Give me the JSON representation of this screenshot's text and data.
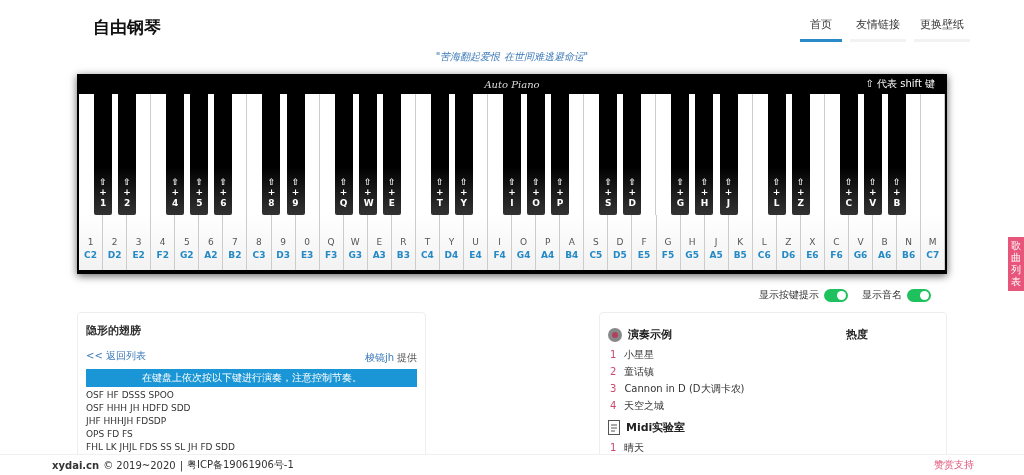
{
  "header": {
    "title": "自由钢琴",
    "nav": [
      {
        "label": "首页",
        "selected": true
      },
      {
        "label": "友情链接",
        "selected": false
      },
      {
        "label": "更换壁纸",
        "selected": false
      }
    ]
  },
  "motto": "\"苦海翻起爱恨 在世间难逃避命运\"",
  "piano": {
    "brand": "Auto Piano",
    "shift_note": "⇧ 代表 shift 键",
    "keys": [
      {
        "key": "1",
        "note": "C2",
        "black": "⇧ + 1"
      },
      {
        "key": "2",
        "note": "D2",
        "black": "⇧ + 2"
      },
      {
        "key": "3",
        "note": "E2"
      },
      {
        "key": "4",
        "note": "F2",
        "black": "⇧ + 4"
      },
      {
        "key": "5",
        "note": "G2",
        "black": "⇧ + 5"
      },
      {
        "key": "6",
        "note": "A2",
        "black": "⇧ + 6"
      },
      {
        "key": "7",
        "note": "B2"
      },
      {
        "key": "8",
        "note": "C3",
        "black": "⇧ + 8"
      },
      {
        "key": "9",
        "note": "D3",
        "black": "⇧ + 9"
      },
      {
        "key": "0",
        "note": "E3"
      },
      {
        "key": "Q",
        "note": "F3",
        "black": "⇧ + Q"
      },
      {
        "key": "W",
        "note": "G3",
        "black": "⇧ + W"
      },
      {
        "key": "E",
        "note": "A3",
        "black": "⇧ + E"
      },
      {
        "key": "R",
        "note": "B3"
      },
      {
        "key": "T",
        "note": "C4",
        "black": "⇧ + T"
      },
      {
        "key": "Y",
        "note": "D4",
        "black": "⇧ + Y"
      },
      {
        "key": "U",
        "note": "E4"
      },
      {
        "key": "I",
        "note": "F4",
        "black": "⇧ + I"
      },
      {
        "key": "O",
        "note": "G4",
        "black": "⇧ + O"
      },
      {
        "key": "P",
        "note": "A4",
        "black": "⇧ + P"
      },
      {
        "key": "A",
        "note": "B4"
      },
      {
        "key": "S",
        "note": "C5",
        "black": "⇧ + S"
      },
      {
        "key": "D",
        "note": "D5",
        "black": "⇧ + D"
      },
      {
        "key": "F",
        "note": "E5"
      },
      {
        "key": "G",
        "note": "F5",
        "black": "⇧ + G"
      },
      {
        "key": "H",
        "note": "G5",
        "black": "⇧ + H"
      },
      {
        "key": "J",
        "note": "A5",
        "black": "⇧ + J"
      },
      {
        "key": "K",
        "note": "B5"
      },
      {
        "key": "L",
        "note": "C6",
        "black": "⇧ + L"
      },
      {
        "key": "Z",
        "note": "D6",
        "black": "⇧ + Z"
      },
      {
        "key": "X",
        "note": "E6"
      },
      {
        "key": "C",
        "note": "F6",
        "black": "⇧ + C"
      },
      {
        "key": "V",
        "note": "G6",
        "black": "⇧ + V"
      },
      {
        "key": "B",
        "note": "A6",
        "black": "⇧ + B"
      },
      {
        "key": "N",
        "note": "B6"
      },
      {
        "key": "M",
        "note": "C7"
      }
    ]
  },
  "side_tab": "歌曲列表",
  "toggles": [
    {
      "label": "显示按键提示",
      "on": true
    },
    {
      "label": "显示音名",
      "on": true
    }
  ],
  "score": {
    "title": "隐形的翅膀",
    "back_link": "<< 返回列表",
    "author": "梭镜jh",
    "provided": "提供",
    "notice": "在键盘上依次按以下键进行演奏，注意控制节奏。",
    "lines": [
      "OSF HF DSSS SPOO",
      "OSF HHH JH HDFD SDD",
      "JHF HHHJH FDSDP",
      "OPS FD FS",
      "FHL LK JHJL FDS SS SL JH FD SDD"
    ]
  },
  "lists": {
    "heat_label": "热度",
    "sections": [
      {
        "kind": "examples",
        "title": "演奏示例",
        "items": [
          {
            "num": "1",
            "name": "小星星"
          },
          {
            "num": "2",
            "name": "童话镇"
          },
          {
            "num": "3",
            "name": "Cannon in D (D大调卡农)"
          },
          {
            "num": "4",
            "name": "天空之城"
          }
        ]
      },
      {
        "kind": "midi",
        "title": "Midi实验室",
        "items": [
          {
            "num": "1",
            "name": "晴天"
          }
        ]
      }
    ]
  },
  "footer": {
    "site": "xydai.cn",
    "copyright": "© 2019~2020",
    "separator": "|",
    "icp": "粤ICP备19061906号-1",
    "donate": "赞赏支持"
  }
}
